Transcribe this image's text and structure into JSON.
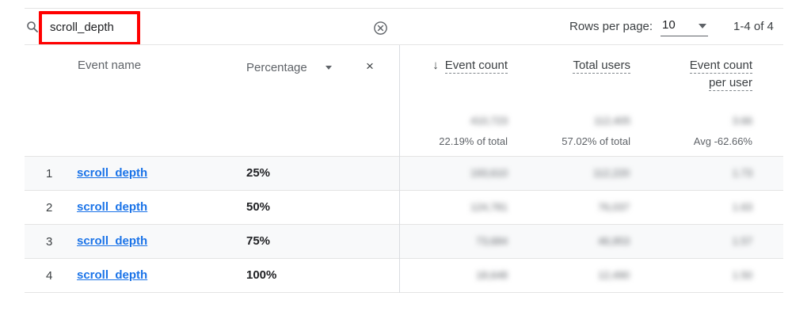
{
  "toolbar": {
    "search_value": "scroll_depth",
    "rows_per_page_label": "Rows per page:",
    "rows_per_page_value": "10",
    "range_text": "1-4 of 4"
  },
  "header": {
    "event_name": "Event name",
    "percentage": "Percentage",
    "close": "×",
    "event_count": "Event count",
    "total_users": "Total users",
    "event_count_per_user_line1": "Event count",
    "event_count_per_user_line2": "per user",
    "sort_arrow": "↓"
  },
  "totals": {
    "event_count_value": "410,723",
    "event_count_sub": "22.19% of total",
    "total_users_value": "112,405",
    "total_users_sub": "57.02% of total",
    "per_user_value": "3.66",
    "per_user_sub": "Avg -62.66%"
  },
  "rows": [
    {
      "index": "1",
      "name": "scroll_depth",
      "percentage": "25%",
      "event_count": "193,610",
      "total_users": "112,220",
      "per_user": "1.73"
    },
    {
      "index": "2",
      "name": "scroll_depth",
      "percentage": "50%",
      "event_count": "124,781",
      "total_users": "76,037",
      "per_user": "1.63"
    },
    {
      "index": "3",
      "name": "scroll_depth",
      "percentage": "75%",
      "event_count": "73,684",
      "total_users": "46,953",
      "per_user": "1.57"
    },
    {
      "index": "4",
      "name": "scroll_depth",
      "percentage": "100%",
      "event_count": "18,648",
      "total_users": "12,490",
      "per_user": "1.50"
    }
  ],
  "colors": {
    "highlight_border": "#ff0000",
    "link": "#1a73e8",
    "row_shade": "#f8f9fa"
  },
  "icons": {
    "search": "search-icon",
    "clear": "clear-circle-icon",
    "dropdown": "caret-down-icon",
    "close": "close-icon",
    "sort": "arrow-down-icon"
  }
}
